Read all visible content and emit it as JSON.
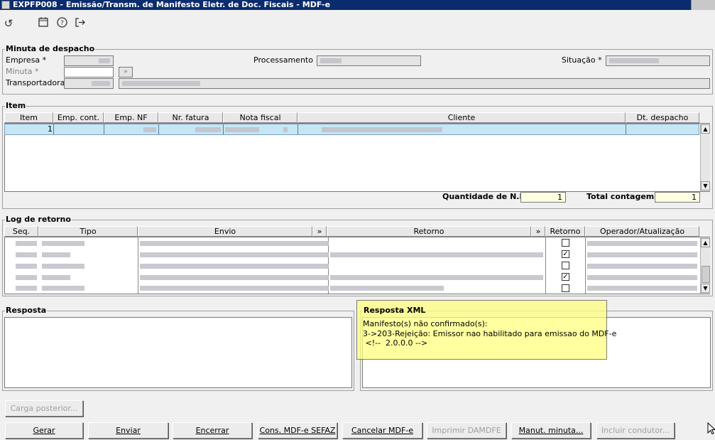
{
  "window": {
    "title": "EXPFP008 - Emissão/Transm. de Manifesto Eletr. de Doc. Fiscais - MDF-e"
  },
  "toolbar": {
    "icons": [
      "undo-icon",
      "calendar-icon",
      "help-icon",
      "exit-icon"
    ]
  },
  "minuta": {
    "title": "Minuta de despacho",
    "empresa_label": "Empresa *",
    "minuta_label": "Minuta *",
    "transportadora_label": "Transportadora",
    "processamento_label": "Processamento",
    "situacao_label": "Situação *"
  },
  "item": {
    "title": "Item",
    "columns": [
      "Item",
      "Emp. cont.",
      "Emp. NF",
      "Nr. fatura",
      "Nota fiscal",
      "Cliente",
      "Dt. despacho"
    ],
    "row_item": "1",
    "qtd_label": "Quantidade de N.F.",
    "qtd_value": "1",
    "total_label": "Total contagem",
    "total_value": "1"
  },
  "log": {
    "title": "Log de retorno",
    "columns": [
      "Seq.",
      "Tipo",
      "Envio",
      "Retorno",
      "Retorno",
      "Operador/Atualização"
    ],
    "expand_label": "»",
    "checks": [
      "",
      "✓",
      "",
      "✓",
      ""
    ]
  },
  "resposta": {
    "title": "Resposta"
  },
  "resposta_xml": {
    "title": "Resposta XML",
    "lines": [
      "Manifesto(s) não confirmado(s):",
      "3->203-Rejeição: Emissor nao habilitado para emissao do MDF-e",
      " <!--  2.0.0.0 -->"
    ]
  },
  "buttons": {
    "carga": "Carga posterior...",
    "gerar": "Gerar",
    "enviar": "Enviar",
    "encerrar": "Encerrar",
    "cons": "Cons. MDF-e SEFAZ",
    "cancelar": "Cancelar MDF-e",
    "imprimir": "Imprimir DAMDFE",
    "manut": "Manut. minuta...",
    "incluir": "Incluir condutor..."
  }
}
